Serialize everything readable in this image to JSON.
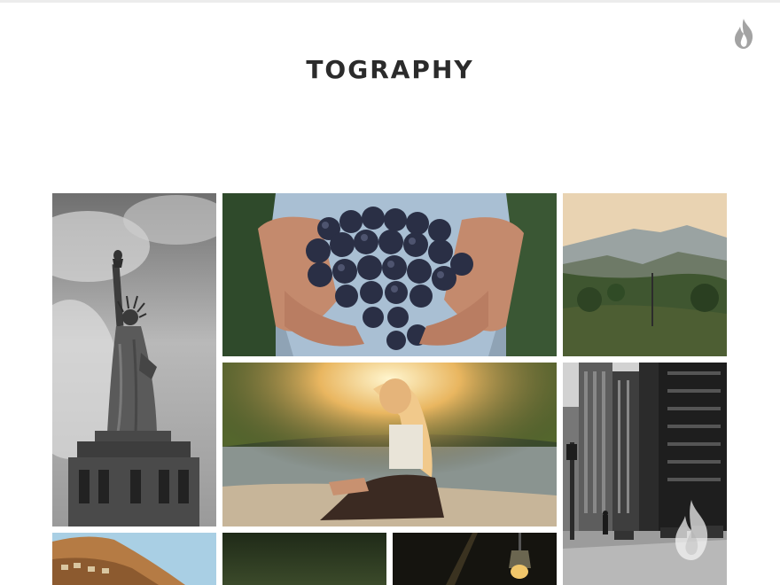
{
  "site": {
    "title": "TOGRAPHY",
    "logo_icon": "flame-icon",
    "watermark_icon": "flame-icon"
  },
  "gallery": {
    "photos": [
      {
        "name": "statue-of-liberty-photo"
      },
      {
        "name": "grapes-in-hands-photo"
      },
      {
        "name": "mountain-valley-photo"
      },
      {
        "name": "woman-sunset-lake-photo"
      },
      {
        "name": "city-street-photo"
      },
      {
        "name": "cliff-town-photo"
      },
      {
        "name": "dark-green-photo"
      },
      {
        "name": "hanging-lamp-photo"
      }
    ]
  },
  "colors": {
    "title": "#2b2b2b",
    "background": "#ffffff",
    "icon": "#9a9a9a"
  }
}
